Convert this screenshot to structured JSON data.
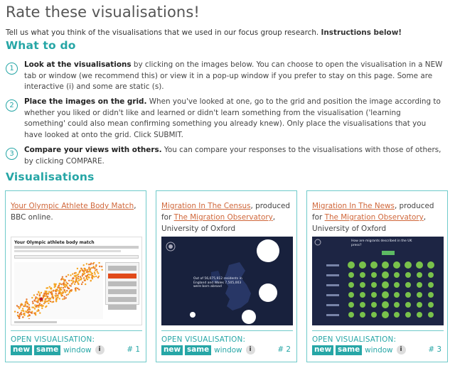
{
  "page": {
    "title": "Rate these visualisations!",
    "intro_text": "Tell us what you think of the visualisations that we used in our focus group research.",
    "intro_bold": "Instructions below!"
  },
  "what_to_do": {
    "heading": "What to do",
    "steps": [
      {
        "num": "1",
        "bold": "Look at the visualisations",
        "text": " by clicking on the images below. You can choose to open the visualisation in a NEW tab or window (we recommend this) or view it in a pop-up window if you prefer to stay on this page. Some are interactive (i) and some are static (s)."
      },
      {
        "num": "2",
        "bold": "Place the images on the grid.",
        "text": " When you've looked at one, go to the grid and position the image according to whether you liked or didn't like and learned or didn't learn something from the visualisation ('learning something' could also mean confirming something you already knew). Only place the visualisations that you have looked at onto the grid. Click SUBMIT."
      },
      {
        "num": "3",
        "bold": "Compare your views with others.",
        "text": " You can compare your responses to the visualisations with those of others, by clicking COMPARE."
      }
    ]
  },
  "visualisations": {
    "heading": "Visualisations",
    "open_label": "OPEN VISUALISATION:",
    "new_label": "new",
    "same_label": "same",
    "window_label": "window",
    "info_label": "i",
    "cards": [
      {
        "link": "Your Olympic Athlete Body Match",
        "mid": ",",
        "producer_link": "",
        "rest": "BBC online.",
        "number": "# 1",
        "thumb_title": "Your Olympic athlete body match"
      },
      {
        "link": "Migration In The Census",
        "mid": ", produced for ",
        "producer_link": "The Migration Observatory",
        "rest": ", University of Oxford",
        "number": "# 2",
        "thumb_text": "Out of 56,075,912 residents in England and Wales 7,505,003 were born abroad"
      },
      {
        "link": "Migration In The News",
        "mid": ", produced for ",
        "producer_link": "The Migration Observatory",
        "rest": ", University of Oxford",
        "number": "# 3",
        "thumb_text": "How are migrants described in the UK press?"
      }
    ]
  },
  "colors": {
    "accent": "#26a6a6",
    "link": "#d0673a",
    "card_border": "#6fcaca"
  }
}
